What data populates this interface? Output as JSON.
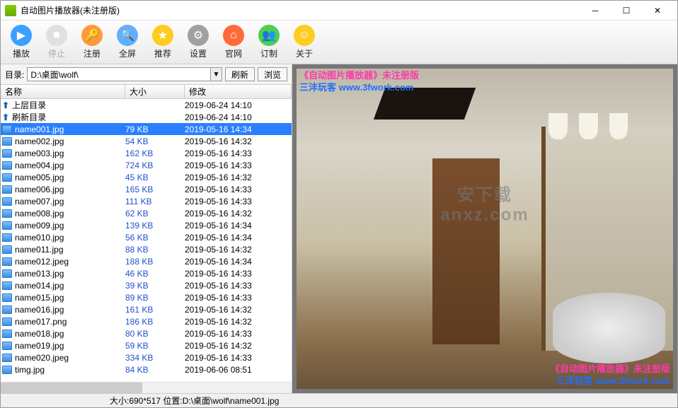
{
  "window": {
    "title": "自动图片播放器(未注册版)"
  },
  "toolbar": [
    {
      "id": "play",
      "label": "播放",
      "color": "#3aa0ff",
      "glyph": "▶"
    },
    {
      "id": "stop",
      "label": "停止",
      "color": "#d0d0d0",
      "glyph": "■",
      "disabled": true
    },
    {
      "id": "register",
      "label": "注册",
      "color": "#ff9a3a",
      "glyph": "🔑"
    },
    {
      "id": "fullscreen",
      "label": "全屏",
      "color": "#5fb0ff",
      "glyph": "🔍"
    },
    {
      "id": "recommend",
      "label": "推荐",
      "color": "#ffcc20",
      "glyph": "★"
    },
    {
      "id": "settings",
      "label": "设置",
      "color": "#a0a0a0",
      "glyph": "⚙"
    },
    {
      "id": "website",
      "label": "官网",
      "color": "#ff6a3a",
      "glyph": "⌂"
    },
    {
      "id": "custom",
      "label": "订制",
      "color": "#4fcf4f",
      "glyph": "👥"
    },
    {
      "id": "about",
      "label": "关于",
      "color": "#ffcc20",
      "glyph": "☺"
    }
  ],
  "pathbar": {
    "label": "目录:",
    "path": "D:\\桌面\\wolf\\",
    "refresh": "刷新",
    "browse": "浏览"
  },
  "columns": {
    "name": "名称",
    "size": "大小",
    "modified": "修改"
  },
  "dirs": [
    {
      "name": "上层目录",
      "modified": "2019-06-24 14:10"
    },
    {
      "name": "刷新目录",
      "modified": "2019-06-24 14:10"
    }
  ],
  "files": [
    {
      "name": "name001.jpg",
      "size": "79 KB",
      "modified": "2019-05-16 14:34",
      "selected": true
    },
    {
      "name": "name002.jpg",
      "size": "54 KB",
      "modified": "2019-05-16 14:32"
    },
    {
      "name": "name003.jpg",
      "size": "162 KB",
      "modified": "2019-05-16 14:33"
    },
    {
      "name": "name004.jpg",
      "size": "724 KB",
      "modified": "2019-05-16 14:33"
    },
    {
      "name": "name005.jpg",
      "size": "45 KB",
      "modified": "2019-05-16 14:32"
    },
    {
      "name": "name006.jpg",
      "size": "165 KB",
      "modified": "2019-05-16 14:33"
    },
    {
      "name": "name007.jpg",
      "size": "111 KB",
      "modified": "2019-05-16 14:33"
    },
    {
      "name": "name008.jpg",
      "size": "62 KB",
      "modified": "2019-05-16 14:32"
    },
    {
      "name": "name009.jpg",
      "size": "139 KB",
      "modified": "2019-05-16 14:34"
    },
    {
      "name": "name010.jpg",
      "size": "56 KB",
      "modified": "2019-05-16 14:34"
    },
    {
      "name": "name011.jpg",
      "size": "88 KB",
      "modified": "2019-05-16 14:32"
    },
    {
      "name": "name012.jpeg",
      "size": "188 KB",
      "modified": "2019-05-16 14:34"
    },
    {
      "name": "name013.jpg",
      "size": "46 KB",
      "modified": "2019-05-16 14:33"
    },
    {
      "name": "name014.jpg",
      "size": "39 KB",
      "modified": "2019-05-16 14:33"
    },
    {
      "name": "name015.jpg",
      "size": "89 KB",
      "modified": "2019-05-16 14:33"
    },
    {
      "name": "name016.jpg",
      "size": "161 KB",
      "modified": "2019-05-16 14:32"
    },
    {
      "name": "name017.png",
      "size": "186 KB",
      "modified": "2019-05-16 14:32"
    },
    {
      "name": "name018.jpg",
      "size": "80 KB",
      "modified": "2019-05-16 14:33"
    },
    {
      "name": "name019.jpg",
      "size": "59 KB",
      "modified": "2019-05-16 14:32"
    },
    {
      "name": "name020.jpeg",
      "size": "334 KB",
      "modified": "2019-05-16 14:33"
    },
    {
      "name": "timg.jpg",
      "size": "84 KB",
      "modified": "2019-06-06 08:51"
    }
  ],
  "watermark": {
    "line1": "《自动图片播放器》未注册版",
    "line2": "三沣玩客 www.3fwork.com"
  },
  "center_watermark": "安下载\nanxz.com",
  "statusbar": {
    "info": "大小:690*517 位置:D:\\桌面\\wolf\\name001.jpg"
  }
}
